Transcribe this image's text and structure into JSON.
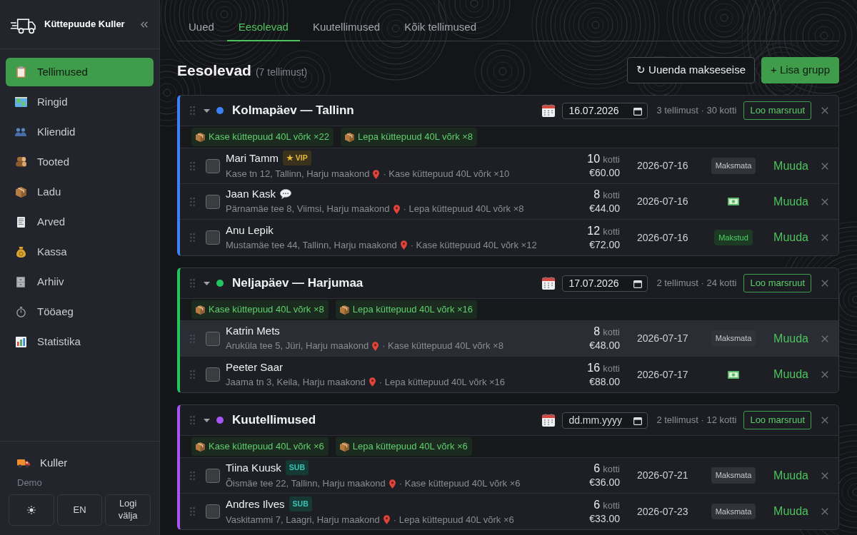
{
  "sidebar": {
    "brand": "Küttepuude Kuller",
    "items": [
      {
        "label": "Tellimused",
        "selected": true
      },
      {
        "label": "Ringid",
        "selected": false
      },
      {
        "label": "Kliendid",
        "selected": false
      },
      {
        "label": "Tooted",
        "selected": false
      },
      {
        "label": "Ladu",
        "selected": false
      },
      {
        "label": "Arved",
        "selected": false
      },
      {
        "label": "Kassa",
        "selected": false
      },
      {
        "label": "Arhiiv",
        "selected": false
      },
      {
        "label": "Tööaeg",
        "selected": false
      },
      {
        "label": "Statistika",
        "selected": false
      }
    ],
    "user": {
      "name": "Kuller",
      "role": "Demo"
    },
    "footer_buttons": [
      {
        "kind": "theme"
      },
      {
        "kind": "text",
        "label": "EN"
      },
      {
        "kind": "text",
        "label": "Logi välja"
      }
    ]
  },
  "tabs": [
    {
      "label": "Uued",
      "selected": false
    },
    {
      "label": "Eesolevad",
      "selected": true
    },
    {
      "label": "Kuutellimused",
      "selected": false
    },
    {
      "label": "Kõik tellimused",
      "selected": false
    }
  ],
  "page_header": {
    "title": "Eesolevad",
    "count": "(7 tellimust)",
    "buttons": [
      {
        "kind": "outline",
        "label": "↻ Uuenda makseseise"
      },
      {
        "kind": "primary",
        "label": "+ Lisa grupp"
      }
    ]
  },
  "groups": [
    {
      "name": "Kolmapäev — Tallinn",
      "color": "#3b82f6",
      "expanded": true,
      "date": {
        "value": "16.07.2026"
      },
      "summary": "3 tellimust · 30 kotti",
      "route_button": "Loo marsruut",
      "products": [
        "Kase küttepuud 40L võrk ×22",
        "Lepa küttepuud 40L võrk ×8"
      ],
      "orders": [
        {
          "name": "Mari Tamm",
          "badge": {
            "kind": "vip",
            "label": "★ VIP"
          },
          "has_comment": false,
          "checked": false,
          "highlighted": false,
          "address": "Kase tn 12, Tallinn, Harju maakond",
          "product": "· Kase küttepuud 40L võrk ×10",
          "bags": "10",
          "unit": "kotti",
          "price": "€60.00",
          "date": "2026-07-16",
          "payment": {
            "kind": "unpaid",
            "label": "Maksmata"
          },
          "action": "Muuda"
        },
        {
          "name": "Jaan Kask",
          "has_comment": true,
          "checked": false,
          "highlighted": false,
          "address": "Pärnamäe tee 8, Viimsi, Harju maakond",
          "product": "· Lepa küttepuud 40L võrk ×8",
          "bags": "8",
          "unit": "kotti",
          "price": "€44.00",
          "date": "2026-07-16",
          "payment": {
            "kind": "cash"
          },
          "action": "Muuda"
        },
        {
          "name": "Anu Lepik",
          "has_comment": false,
          "checked": false,
          "highlighted": false,
          "address": "Mustamäe tee 44, Tallinn, Harju maakond",
          "product": "· Kase küttepuud 40L võrk ×12",
          "bags": "12",
          "unit": "kotti",
          "price": "€72.00",
          "date": "2026-07-16",
          "payment": {
            "kind": "paid",
            "label": "Makstud"
          },
          "action": "Muuda"
        }
      ]
    },
    {
      "name": "Neljapäev — Harjumaa",
      "color": "#22c55e",
      "expanded": true,
      "date": {
        "value": "17.07.2026"
      },
      "summary": "2 tellimust · 24 kotti",
      "route_button": "Loo marsruut",
      "products": [
        "Kase küttepuud 40L võrk ×8",
        "Lepa küttepuud 40L võrk ×16"
      ],
      "orders": [
        {
          "name": "Katrin Mets",
          "has_comment": false,
          "checked": false,
          "highlighted": true,
          "address": "Aruküla tee 5, Jüri, Harju maakond",
          "product": "· Kase küttepuud 40L võrk ×8",
          "bags": "8",
          "unit": "kotti",
          "price": "€48.00",
          "date": "2026-07-17",
          "payment": {
            "kind": "unpaid",
            "label": "Maksmata"
          },
          "action": "Muuda"
        },
        {
          "name": "Peeter Saar",
          "has_comment": false,
          "checked": false,
          "highlighted": false,
          "address": "Jaama tn 3, Keila, Harju maakond",
          "product": "· Lepa küttepuud 40L võrk ×16",
          "bags": "16",
          "unit": "kotti",
          "price": "€88.00",
          "date": "2026-07-17",
          "payment": {
            "kind": "cash"
          },
          "action": "Muuda"
        }
      ]
    },
    {
      "name": "Kuutellimused",
      "color": "#a855f7",
      "expanded": true,
      "date": {
        "placeholder": "dd.mm.yyyy"
      },
      "summary": "2 tellimust · 12 kotti",
      "route_button": "Loo marsruut",
      "products": [
        "Kase küttepuud 40L võrk ×6",
        "Lepa küttepuud 40L võrk ×6"
      ],
      "orders": [
        {
          "name": "Tiina Kuusk",
          "badge": {
            "kind": "sub",
            "label": "SUB"
          },
          "has_comment": false,
          "checked": false,
          "highlighted": false,
          "address": "Õismäe tee 22, Tallinn, Harju maakond",
          "product": "· Kase küttepuud 40L võrk ×6",
          "bags": "6",
          "unit": "kotti",
          "price": "€36.00",
          "date": "2026-07-21",
          "payment": {
            "kind": "unpaid",
            "label": "Maksmata"
          },
          "action": "Muuda"
        },
        {
          "name": "Andres Ilves",
          "badge": {
            "kind": "sub",
            "label": "SUB"
          },
          "has_comment": false,
          "checked": false,
          "highlighted": false,
          "address": "Vaskitammi 7, Laagri, Harju maakond",
          "product": "· Lepa küttepuud 40L võrk ×6",
          "bags": "6",
          "unit": "kotti",
          "price": "€33.00",
          "date": "2026-07-23",
          "payment": {
            "kind": "unpaid",
            "label": "Maksmata"
          },
          "action": "Muuda"
        }
      ]
    }
  ]
}
